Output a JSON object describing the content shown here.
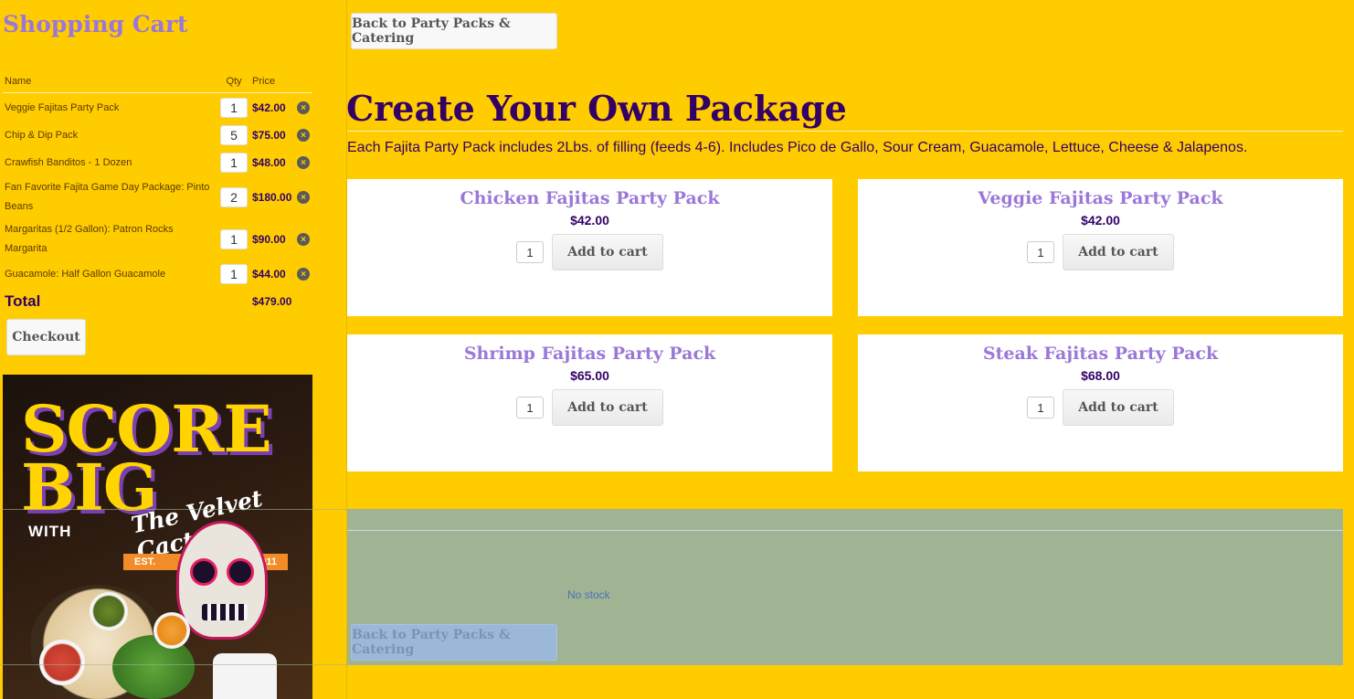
{
  "cart": {
    "title": "Shopping Cart",
    "headers": {
      "name": "Name",
      "qty": "Qty",
      "price": "Price"
    },
    "items": [
      {
        "name": "Veggie Fajitas Party Pack",
        "qty": "1",
        "price": "$42.00"
      },
      {
        "name": "Chip & Dip Pack",
        "qty": "5",
        "price": "$75.00"
      },
      {
        "name": "Crawfish Banditos - 1 Dozen",
        "qty": "1",
        "price": "$48.00"
      },
      {
        "name": "Fan Favorite Fajita Game Day Package: Pinto Beans",
        "qty": "2",
        "price": "$180.00"
      },
      {
        "name": "Margaritas (1/2 Gallon): Patron Rocks Margarita",
        "qty": "1",
        "price": "$90.00"
      },
      {
        "name": "Guacamole: Half Gallon Guacamole",
        "qty": "1",
        "price": "$44.00"
      }
    ],
    "remove_glyph": "×",
    "total_label": "Total",
    "total_value": "$479.00",
    "checkout_label": "Checkout"
  },
  "promo": {
    "line1": "SCORE",
    "line2": "BIG",
    "with": "WITH",
    "brand": "The Velvet Cactus",
    "est_label": "EST.",
    "est_year": "2011"
  },
  "main": {
    "back_label": "Back to Party Packs & Catering",
    "title": "Create Your Own Package",
    "description": "Each Fajita Party Pack includes 2Lbs. of filling (feeds 4-6). Includes Pico de Gallo, Sour Cream, Guacamole, Lettuce, Cheese & Jalapenos.",
    "add_to_cart_label": "Add to cart",
    "products": [
      {
        "name": "Chicken Fajitas Party Pack",
        "price": "$42.00",
        "qty": "1"
      },
      {
        "name": "Veggie Fajitas Party Pack",
        "price": "$42.00",
        "qty": "1"
      },
      {
        "name": "Shrimp Fajitas Party Pack",
        "price": "$65.00",
        "qty": "1"
      },
      {
        "name": "Steak Fajitas Party Pack",
        "price": "$68.00",
        "qty": "1"
      }
    ]
  },
  "overlay": {
    "status": "No stock",
    "back_label": "Back to Party Packs & Catering"
  },
  "colors": {
    "background": "#ffcc00",
    "heading_purple": "#330066",
    "product_name_purple": "#9b78d8",
    "overlay_green": "#a0b494"
  }
}
